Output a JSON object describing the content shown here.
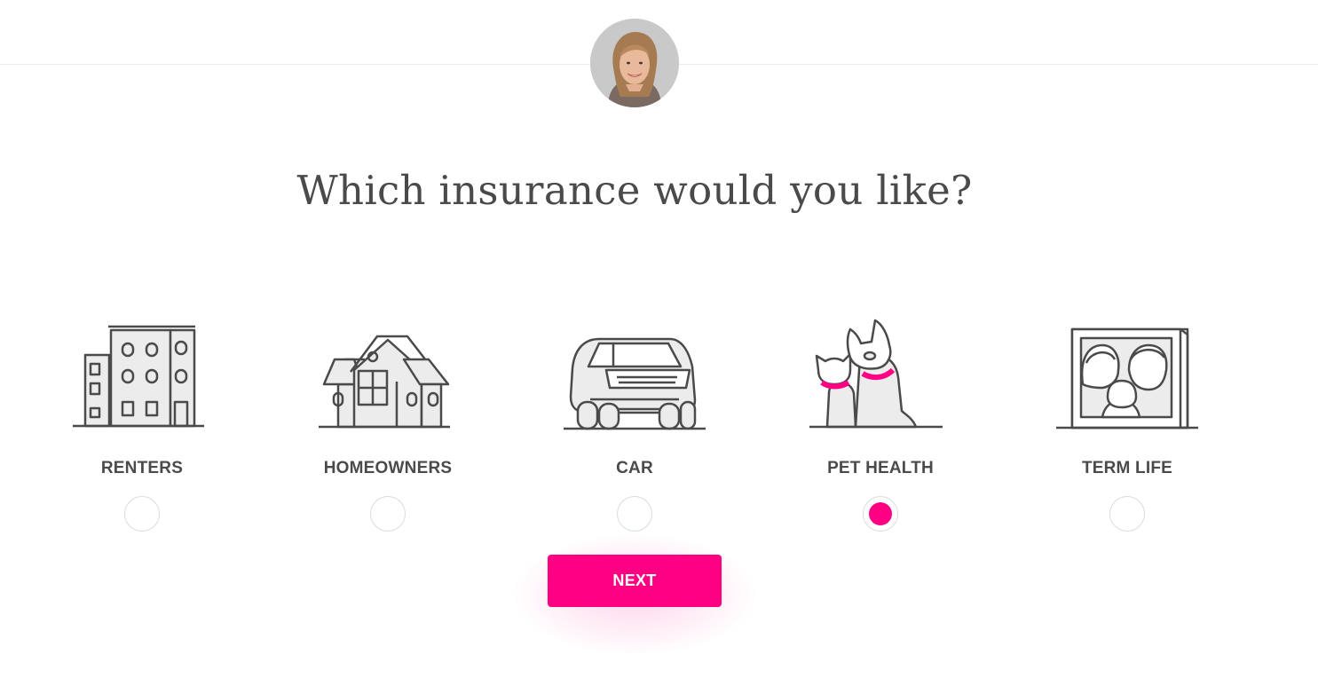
{
  "header": {
    "avatar_icon": "agent-avatar"
  },
  "question": "Which insurance would you like?",
  "options": [
    {
      "id": "renters",
      "label": "RENTERS",
      "icon": "apartment-building-icon",
      "selected": false
    },
    {
      "id": "homeowners",
      "label": "HOMEOWNERS",
      "icon": "house-icon",
      "selected": false
    },
    {
      "id": "car",
      "label": "CAR",
      "icon": "car-icon",
      "selected": false
    },
    {
      "id": "pet",
      "label": "PET HEALTH",
      "icon": "cat-and-dog-icon",
      "selected": true
    },
    {
      "id": "life",
      "label": "TERM LIFE",
      "icon": "family-portrait-icon",
      "selected": false
    }
  ],
  "next_label": "NEXT",
  "colors": {
    "accent": "#ff0083",
    "text": "#4a4a4a",
    "line": "#4a4a4a",
    "fill": "#ececec"
  }
}
